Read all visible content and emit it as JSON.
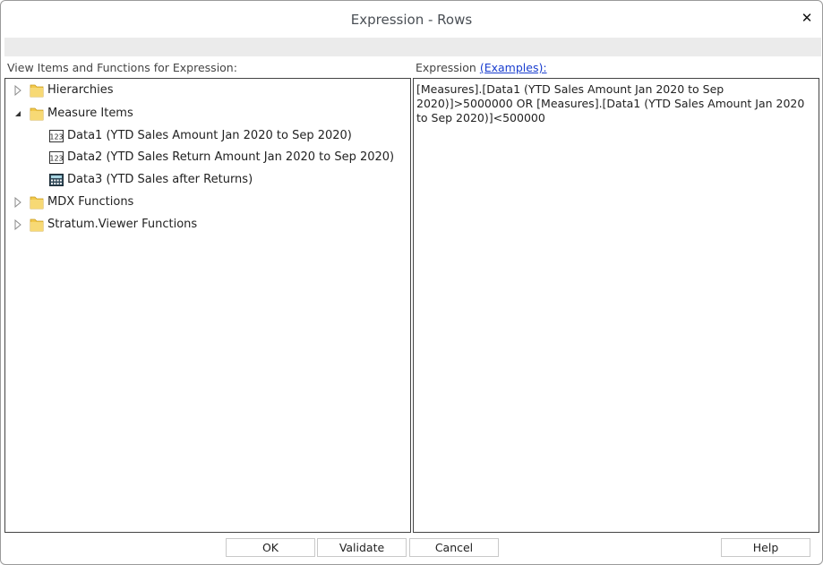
{
  "window": {
    "title": "Expression - Rows",
    "close_label": "✕"
  },
  "left_panel": {
    "heading": "View Items and Functions for Expression:",
    "tree": [
      {
        "label": "Hierarchies",
        "expanded": false,
        "icon": "folder-icon"
      },
      {
        "label": "Measure Items",
        "expanded": true,
        "icon": "folder-icon"
      },
      {
        "label": "Data1 (YTD Sales Amount Jan 2020 to Sep 2020)",
        "icon": "numeric-measure-icon"
      },
      {
        "label": "Data2 (YTD Sales Return Amount Jan 2020 to Sep 2020)",
        "icon": "numeric-measure-icon"
      },
      {
        "label": "Data3 (YTD Sales after Returns)",
        "icon": "calculator-icon"
      },
      {
        "label": "MDX Functions",
        "expanded": false,
        "icon": "folder-icon"
      },
      {
        "label": "Stratum.Viewer Functions",
        "expanded": false,
        "icon": "folder-icon"
      }
    ]
  },
  "right_panel": {
    "heading": "Expression",
    "examples_link": "(Examples):",
    "expression": "[Measures].[Data1 (YTD Sales Amount Jan 2020 to Sep 2020)]>5000000 OR [Measures].[Data1 (YTD Sales Amount Jan 2020 to Sep 2020)]<500000"
  },
  "buttons": {
    "ok": "OK",
    "validate": "Validate",
    "cancel": "Cancel",
    "help": "Help"
  },
  "colors": {
    "link": "#1a3ecf",
    "strip": "#ebebeb",
    "folder": "#f2c94c"
  }
}
